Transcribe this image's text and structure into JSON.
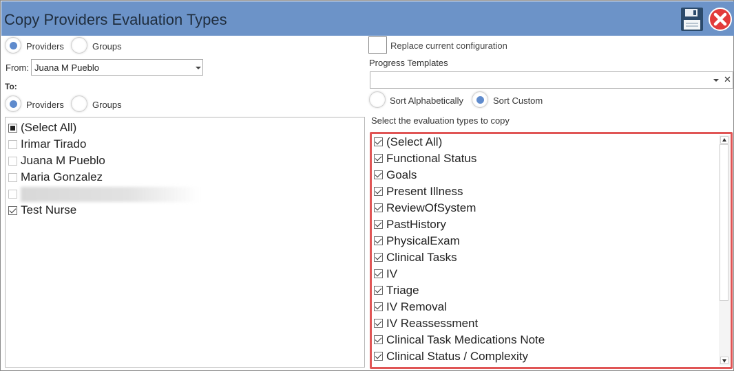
{
  "window": {
    "title": "Copy Providers Evaluation Types"
  },
  "source": {
    "type_options": [
      {
        "label": "Providers",
        "selected": true
      },
      {
        "label": "Groups",
        "selected": false
      }
    ],
    "from_label": "From:",
    "from_value": "Juana M Pueblo"
  },
  "destination": {
    "to_label": "To:",
    "type_options": [
      {
        "label": "Providers",
        "selected": true
      },
      {
        "label": "Groups",
        "selected": false
      }
    ],
    "items": [
      {
        "label": "(Select All)",
        "state": "partial"
      },
      {
        "label": "Irimar Tirado",
        "state": "unchecked"
      },
      {
        "label": "Juana M Pueblo",
        "state": "unchecked"
      },
      {
        "label": "Maria Gonzalez",
        "state": "unchecked"
      },
      {
        "label": "",
        "state": "unchecked",
        "redacted": true
      },
      {
        "label": "Test Nurse",
        "state": "checked"
      }
    ]
  },
  "config": {
    "replace_label": "Replace current configuration",
    "replace_checked": false,
    "progress_templates_label": "Progress Templates",
    "progress_templates_value": "",
    "sort_options": [
      {
        "label": "Sort Alphabetically",
        "selected": false
      },
      {
        "label": "Sort Custom",
        "selected": true
      }
    ],
    "select_types_label": "Select the evaluation types to copy",
    "evaluation_types": [
      {
        "label": "(Select All)",
        "checked": true
      },
      {
        "label": "Functional Status",
        "checked": true
      },
      {
        "label": "Goals",
        "checked": true
      },
      {
        "label": "Present Illness",
        "checked": true
      },
      {
        "label": "ReviewOfSystem",
        "checked": true
      },
      {
        "label": "PastHistory",
        "checked": true
      },
      {
        "label": "PhysicalExam",
        "checked": true
      },
      {
        "label": "Clinical Tasks",
        "checked": true
      },
      {
        "label": "IV",
        "checked": true
      },
      {
        "label": "Triage",
        "checked": true
      },
      {
        "label": "IV Removal",
        "checked": true
      },
      {
        "label": "IV Reassessment",
        "checked": true
      },
      {
        "label": "Clinical Task Medications Note",
        "checked": true
      },
      {
        "label": "Clinical Status / Complexity",
        "checked": true
      }
    ]
  },
  "colors": {
    "titlebar": "#6c93c8",
    "radio_accent": "#5f8bcd",
    "highlight_border": "#e05555"
  },
  "icons": {
    "save": "floppy-disk-icon",
    "close": "close-circle-icon"
  }
}
